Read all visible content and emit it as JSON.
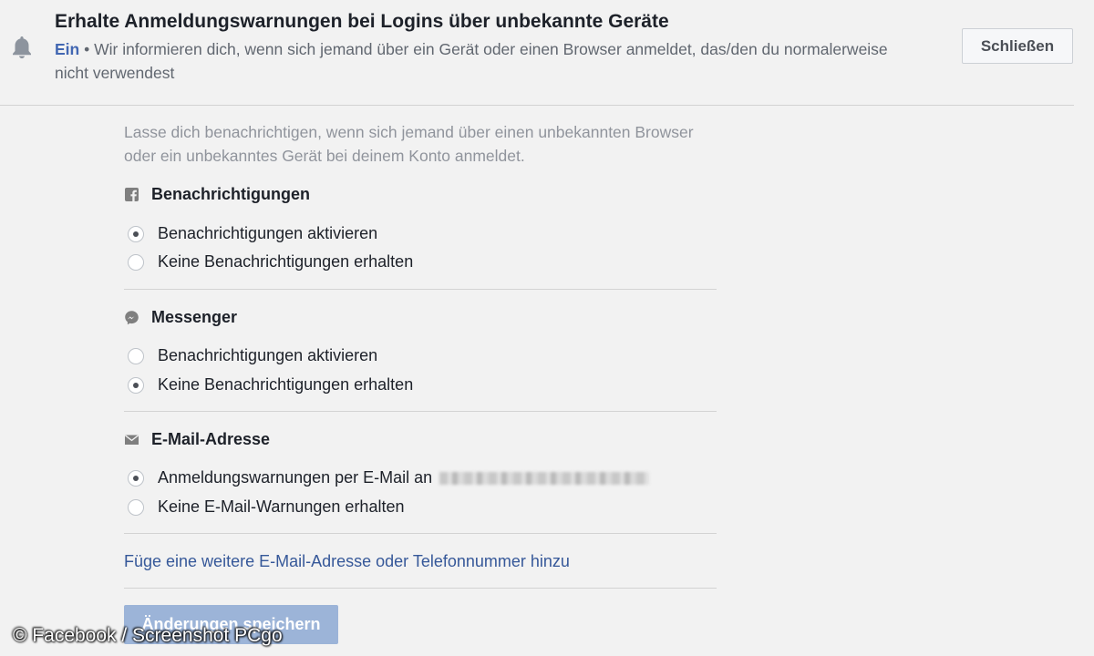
{
  "header": {
    "icon": "bell-icon",
    "title": "Erhalte Anmeldungswarnungen bei Logins über unbekannte Geräte",
    "status": "Ein",
    "separator": " • ",
    "description": "Wir informieren dich, wenn sich jemand über ein Gerät oder einen Browser anmeldet, das/den du normalerweise nicht verwendest",
    "close_label": "Schließen"
  },
  "intro": "Lasse dich benachrichtigen, wenn sich jemand über einen unbekannten Browser oder ein unbekanntes Gerät bei deinem Konto anmeldet.",
  "sections": [
    {
      "icon": "facebook-icon",
      "title": "Benachrichtigungen",
      "options": [
        {
          "label": "Benachrichtigungen aktivieren",
          "checked": true
        },
        {
          "label": "Keine Benachrichtigungen erhalten",
          "checked": false
        }
      ]
    },
    {
      "icon": "messenger-icon",
      "title": "Messenger",
      "options": [
        {
          "label": "Benachrichtigungen aktivieren",
          "checked": false
        },
        {
          "label": "Keine Benachrichtigungen erhalten",
          "checked": true
        }
      ]
    },
    {
      "icon": "envelope-icon",
      "title": "E-Mail-Adresse",
      "options": [
        {
          "label": "Anmeldungswarnungen per E-Mail an",
          "checked": true
        },
        {
          "label": "Keine E-Mail-Warnungen erhalten",
          "checked": false
        }
      ]
    }
  ],
  "add_contact_link": "Füge eine weitere E-Mail-Adresse oder Telefonnummer hinzu",
  "save_label": "Änderungen speichern",
  "watermark": "© Facebook / Screenshot PCgo",
  "colors": {
    "background": "#f2f2f2",
    "accent": "#4267b2",
    "link": "#365899",
    "save_button_disabled": "#9cb4d8"
  }
}
